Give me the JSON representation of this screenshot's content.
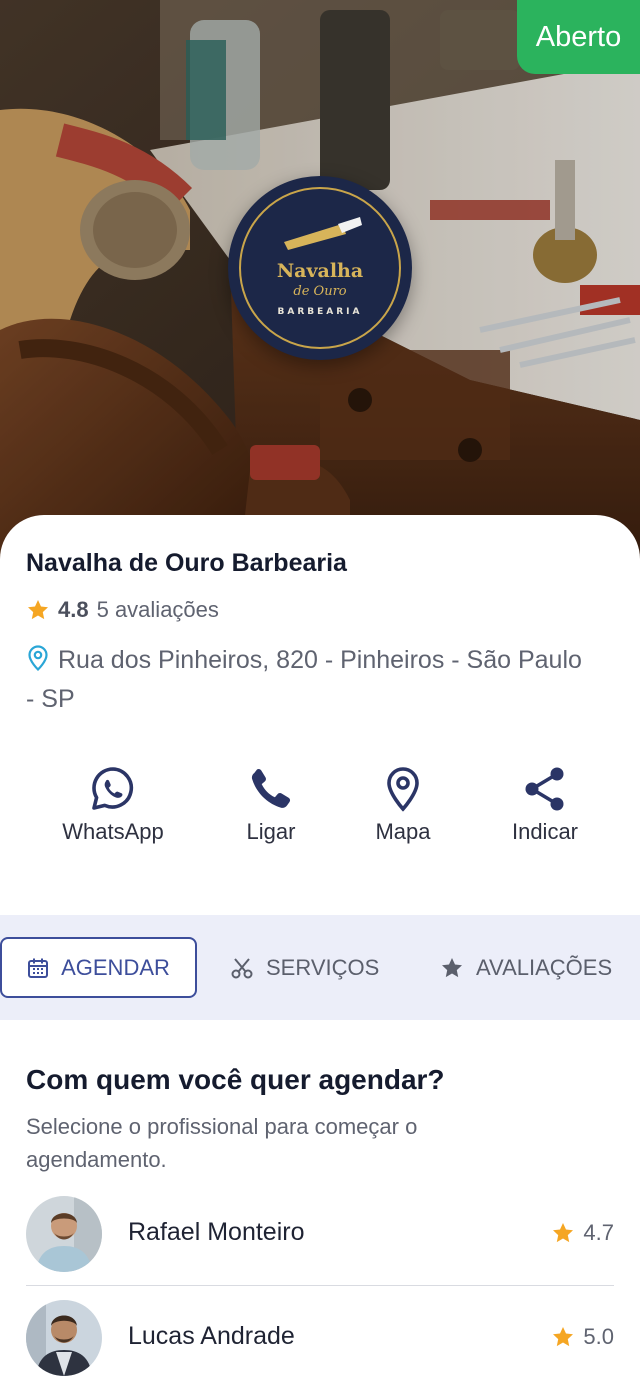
{
  "status": {
    "label": "Aberto",
    "color": "#2bb35d"
  },
  "logo": {
    "line1": "Navalha",
    "line2": "de Ouro",
    "line3": "BARBEARIA"
  },
  "shop": {
    "name": "Navalha de Ouro Barbearia",
    "rating": "4.8",
    "reviews": "5 avaliações",
    "address": "Rua dos Pinheiros, 820 - Pinheiros - São Paulo - SP"
  },
  "actions": [
    {
      "label": "WhatsApp",
      "icon": "whatsapp-icon"
    },
    {
      "label": "Ligar",
      "icon": "phone-icon"
    },
    {
      "label": "Mapa",
      "icon": "map-pin-icon"
    },
    {
      "label": "Indicar",
      "icon": "share-icon"
    }
  ],
  "tabs": [
    {
      "label": "AGENDAR",
      "icon": "calendar-icon",
      "active": true
    },
    {
      "label": "SERVIÇOS",
      "icon": "scissors-icon",
      "active": false
    },
    {
      "label": "AVALIAÇÕES",
      "icon": "star-icon",
      "active": false
    }
  ],
  "schedule": {
    "title": "Com quem você quer agendar?",
    "subtitle": "Selecione o profissional para começar o agendamento.",
    "professionals": [
      {
        "name": "Rafael Monteiro",
        "rating": "4.7"
      },
      {
        "name": "Lucas Andrade",
        "rating": "5.0"
      }
    ]
  },
  "colors": {
    "accent": "#3d4e9b",
    "star": "#f5a623",
    "tabs_bg": "#eceef9"
  }
}
